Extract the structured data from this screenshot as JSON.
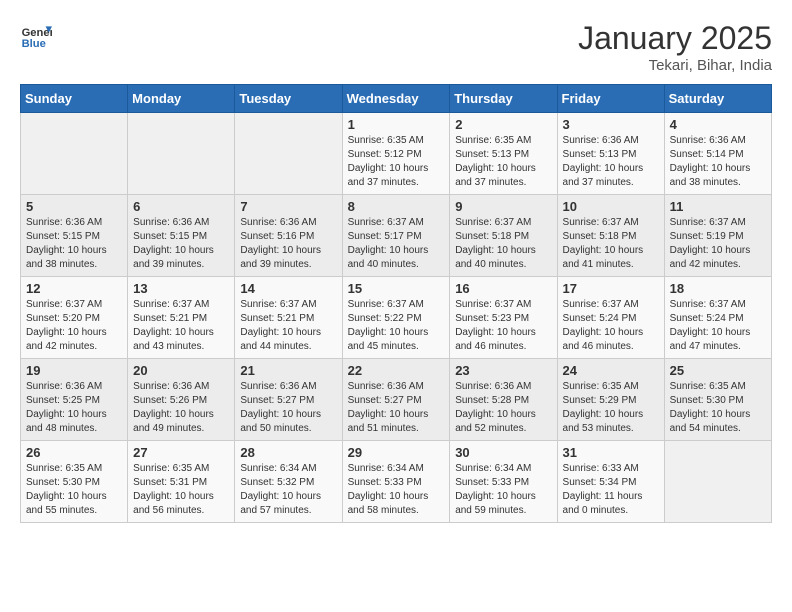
{
  "header": {
    "logo_line1": "General",
    "logo_line2": "Blue",
    "month": "January 2025",
    "location": "Tekari, Bihar, India"
  },
  "weekdays": [
    "Sunday",
    "Monday",
    "Tuesday",
    "Wednesday",
    "Thursday",
    "Friday",
    "Saturday"
  ],
  "weeks": [
    [
      {
        "day": "",
        "sunrise": "",
        "sunset": "",
        "daylight": ""
      },
      {
        "day": "",
        "sunrise": "",
        "sunset": "",
        "daylight": ""
      },
      {
        "day": "",
        "sunrise": "",
        "sunset": "",
        "daylight": ""
      },
      {
        "day": "1",
        "sunrise": "Sunrise: 6:35 AM",
        "sunset": "Sunset: 5:12 PM",
        "daylight": "Daylight: 10 hours and 37 minutes."
      },
      {
        "day": "2",
        "sunrise": "Sunrise: 6:35 AM",
        "sunset": "Sunset: 5:13 PM",
        "daylight": "Daylight: 10 hours and 37 minutes."
      },
      {
        "day": "3",
        "sunrise": "Sunrise: 6:36 AM",
        "sunset": "Sunset: 5:13 PM",
        "daylight": "Daylight: 10 hours and 37 minutes."
      },
      {
        "day": "4",
        "sunrise": "Sunrise: 6:36 AM",
        "sunset": "Sunset: 5:14 PM",
        "daylight": "Daylight: 10 hours and 38 minutes."
      }
    ],
    [
      {
        "day": "5",
        "sunrise": "Sunrise: 6:36 AM",
        "sunset": "Sunset: 5:15 PM",
        "daylight": "Daylight: 10 hours and 38 minutes."
      },
      {
        "day": "6",
        "sunrise": "Sunrise: 6:36 AM",
        "sunset": "Sunset: 5:15 PM",
        "daylight": "Daylight: 10 hours and 39 minutes."
      },
      {
        "day": "7",
        "sunrise": "Sunrise: 6:36 AM",
        "sunset": "Sunset: 5:16 PM",
        "daylight": "Daylight: 10 hours and 39 minutes."
      },
      {
        "day": "8",
        "sunrise": "Sunrise: 6:37 AM",
        "sunset": "Sunset: 5:17 PM",
        "daylight": "Daylight: 10 hours and 40 minutes."
      },
      {
        "day": "9",
        "sunrise": "Sunrise: 6:37 AM",
        "sunset": "Sunset: 5:18 PM",
        "daylight": "Daylight: 10 hours and 40 minutes."
      },
      {
        "day": "10",
        "sunrise": "Sunrise: 6:37 AM",
        "sunset": "Sunset: 5:18 PM",
        "daylight": "Daylight: 10 hours and 41 minutes."
      },
      {
        "day": "11",
        "sunrise": "Sunrise: 6:37 AM",
        "sunset": "Sunset: 5:19 PM",
        "daylight": "Daylight: 10 hours and 42 minutes."
      }
    ],
    [
      {
        "day": "12",
        "sunrise": "Sunrise: 6:37 AM",
        "sunset": "Sunset: 5:20 PM",
        "daylight": "Daylight: 10 hours and 42 minutes."
      },
      {
        "day": "13",
        "sunrise": "Sunrise: 6:37 AM",
        "sunset": "Sunset: 5:21 PM",
        "daylight": "Daylight: 10 hours and 43 minutes."
      },
      {
        "day": "14",
        "sunrise": "Sunrise: 6:37 AM",
        "sunset": "Sunset: 5:21 PM",
        "daylight": "Daylight: 10 hours and 44 minutes."
      },
      {
        "day": "15",
        "sunrise": "Sunrise: 6:37 AM",
        "sunset": "Sunset: 5:22 PM",
        "daylight": "Daylight: 10 hours and 45 minutes."
      },
      {
        "day": "16",
        "sunrise": "Sunrise: 6:37 AM",
        "sunset": "Sunset: 5:23 PM",
        "daylight": "Daylight: 10 hours and 46 minutes."
      },
      {
        "day": "17",
        "sunrise": "Sunrise: 6:37 AM",
        "sunset": "Sunset: 5:24 PM",
        "daylight": "Daylight: 10 hours and 46 minutes."
      },
      {
        "day": "18",
        "sunrise": "Sunrise: 6:37 AM",
        "sunset": "Sunset: 5:24 PM",
        "daylight": "Daylight: 10 hours and 47 minutes."
      }
    ],
    [
      {
        "day": "19",
        "sunrise": "Sunrise: 6:36 AM",
        "sunset": "Sunset: 5:25 PM",
        "daylight": "Daylight: 10 hours and 48 minutes."
      },
      {
        "day": "20",
        "sunrise": "Sunrise: 6:36 AM",
        "sunset": "Sunset: 5:26 PM",
        "daylight": "Daylight: 10 hours and 49 minutes."
      },
      {
        "day": "21",
        "sunrise": "Sunrise: 6:36 AM",
        "sunset": "Sunset: 5:27 PM",
        "daylight": "Daylight: 10 hours and 50 minutes."
      },
      {
        "day": "22",
        "sunrise": "Sunrise: 6:36 AM",
        "sunset": "Sunset: 5:27 PM",
        "daylight": "Daylight: 10 hours and 51 minutes."
      },
      {
        "day": "23",
        "sunrise": "Sunrise: 6:36 AM",
        "sunset": "Sunset: 5:28 PM",
        "daylight": "Daylight: 10 hours and 52 minutes."
      },
      {
        "day": "24",
        "sunrise": "Sunrise: 6:35 AM",
        "sunset": "Sunset: 5:29 PM",
        "daylight": "Daylight: 10 hours and 53 minutes."
      },
      {
        "day": "25",
        "sunrise": "Sunrise: 6:35 AM",
        "sunset": "Sunset: 5:30 PM",
        "daylight": "Daylight: 10 hours and 54 minutes."
      }
    ],
    [
      {
        "day": "26",
        "sunrise": "Sunrise: 6:35 AM",
        "sunset": "Sunset: 5:30 PM",
        "daylight": "Daylight: 10 hours and 55 minutes."
      },
      {
        "day": "27",
        "sunrise": "Sunrise: 6:35 AM",
        "sunset": "Sunset: 5:31 PM",
        "daylight": "Daylight: 10 hours and 56 minutes."
      },
      {
        "day": "28",
        "sunrise": "Sunrise: 6:34 AM",
        "sunset": "Sunset: 5:32 PM",
        "daylight": "Daylight: 10 hours and 57 minutes."
      },
      {
        "day": "29",
        "sunrise": "Sunrise: 6:34 AM",
        "sunset": "Sunset: 5:33 PM",
        "daylight": "Daylight: 10 hours and 58 minutes."
      },
      {
        "day": "30",
        "sunrise": "Sunrise: 6:34 AM",
        "sunset": "Sunset: 5:33 PM",
        "daylight": "Daylight: 10 hours and 59 minutes."
      },
      {
        "day": "31",
        "sunrise": "Sunrise: 6:33 AM",
        "sunset": "Sunset: 5:34 PM",
        "daylight": "Daylight: 11 hours and 0 minutes."
      },
      {
        "day": "",
        "sunrise": "",
        "sunset": "",
        "daylight": ""
      }
    ]
  ]
}
